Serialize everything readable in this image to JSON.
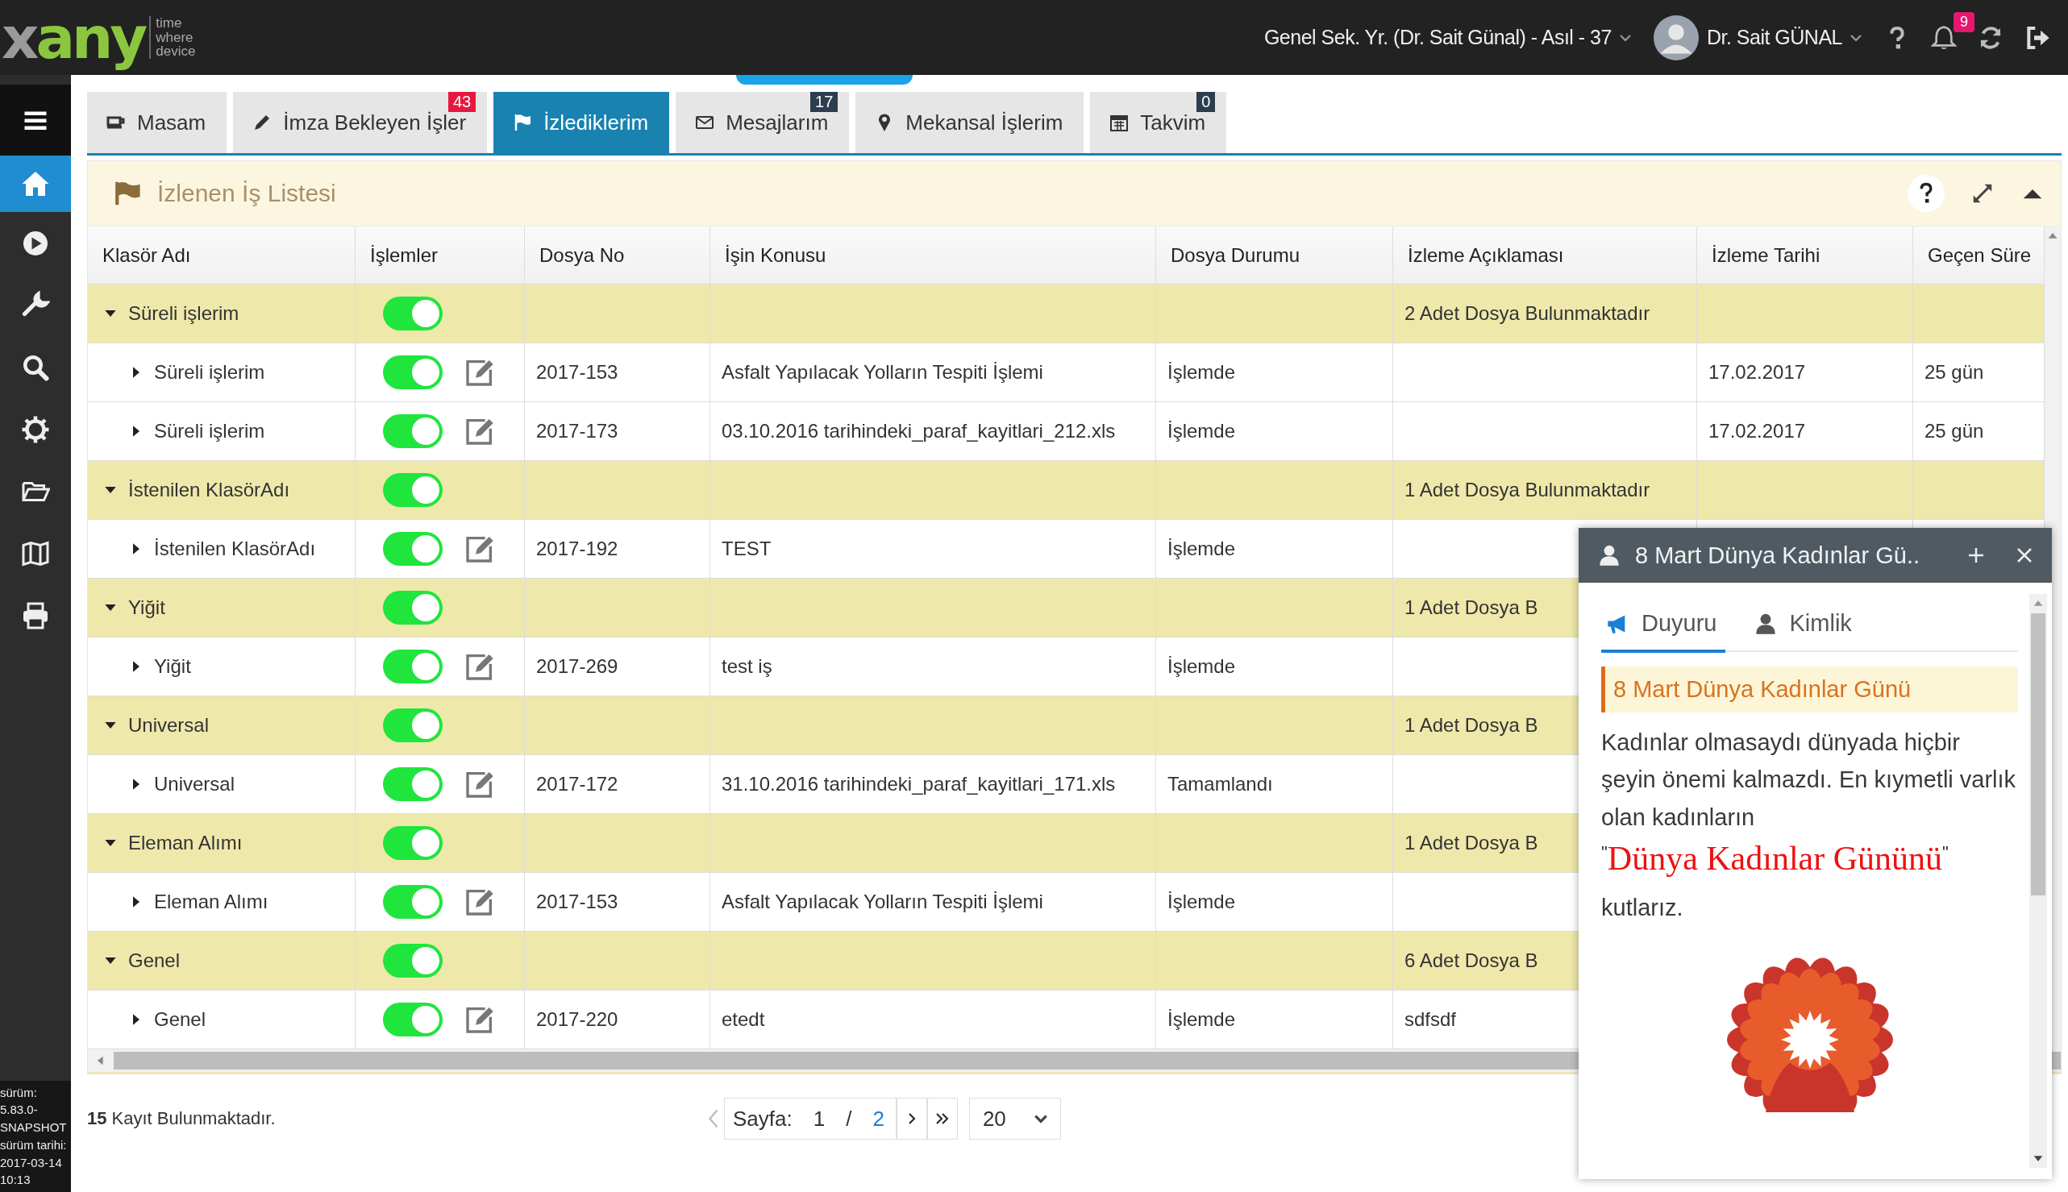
{
  "topbar": {
    "logo": {
      "mark_parts": [
        "x",
        "any"
      ],
      "tagline": [
        "time",
        "where",
        "device"
      ]
    },
    "role": "Genel Sek. Yr. (Dr. Sait Günal) - Asıl - 37",
    "user": "Dr. Sait GÜNAL",
    "notifications": "9"
  },
  "sidebar": {
    "items": [
      {
        "kind": "home",
        "selected": true
      },
      {
        "kind": "play",
        "selected": false
      },
      {
        "kind": "wrench",
        "selected": false
      },
      {
        "kind": "search",
        "selected": false
      },
      {
        "kind": "gear",
        "selected": false
      },
      {
        "kind": "folder",
        "selected": false
      },
      {
        "kind": "map",
        "selected": false
      },
      {
        "kind": "print",
        "selected": false
      }
    ],
    "version_lines": [
      "sürüm:",
      "5.83.0-",
      "SNAPSHOT",
      "sürüm tarihi:",
      "2017-03-14",
      "10:13"
    ]
  },
  "tabs": [
    {
      "label": "Masam",
      "kind": "coffee",
      "selected": false
    },
    {
      "label": "İmza Bekleyen İşler",
      "kind": "pencil",
      "selected": false,
      "badge": {
        "text": "43",
        "color": "#e8173f"
      }
    },
    {
      "label": "İzlediklerim",
      "kind": "flag",
      "selected": true
    },
    {
      "label": "Mesajlarım",
      "kind": "envelope",
      "selected": false,
      "badge": {
        "text": "17",
        "color": "#2c3e50"
      }
    },
    {
      "label": "Mekansal İşlerim",
      "kind": "marker",
      "selected": false
    },
    {
      "label": "Takvim",
      "kind": "calendar",
      "selected": false,
      "badge": {
        "text": "0",
        "color": "#2c3e50"
      }
    }
  ],
  "panel": {
    "title": "İzlenen İş Listesi"
  },
  "table": {
    "columns": [
      "Klasör Adı",
      "İşlemler",
      "Dosya No",
      "İşin Konusu",
      "Dosya Durumu",
      "İzleme Açıklaması",
      "İzleme Tarihi",
      "Geçen Süre"
    ],
    "groups": [
      {
        "folder": "Süreli işlerim",
        "expanded": true,
        "on": true,
        "note": "2 Adet Dosya Bulunmaktadır",
        "children": [
          {
            "folder": "Süreli işlerim",
            "expanded": false,
            "on": true,
            "file_no": "2017-153",
            "subject": "Asfalt Yapılacak Yolların Tespiti İşlemi",
            "status": "İşlemde",
            "date": "17.02.2017",
            "elapsed": "25 gün"
          },
          {
            "folder": "Süreli işlerim",
            "expanded": false,
            "on": true,
            "file_no": "2017-173",
            "subject": "03.10.2016 tarihindeki_paraf_kayitlari_212.xls",
            "status": "İşlemde",
            "date": "17.02.2017",
            "elapsed": "25 gün"
          }
        ]
      },
      {
        "folder": "İstenilen KlasörAdı",
        "expanded": true,
        "on": true,
        "note": "1 Adet Dosya Bulunmaktadır",
        "children": [
          {
            "folder": "İstenilen KlasörAdı",
            "expanded": false,
            "on": true,
            "file_no": "2017-192",
            "subject": "TEST",
            "status": "İşlemde"
          }
        ]
      },
      {
        "folder": "Yiğit",
        "expanded": true,
        "on": true,
        "note": "1 Adet Dosya B",
        "children": [
          {
            "folder": "Yiğit",
            "expanded": false,
            "on": true,
            "file_no": "2017-269",
            "subject": "test iş",
            "status": "İşlemde"
          }
        ]
      },
      {
        "folder": "Universal",
        "expanded": true,
        "on": true,
        "note": "1 Adet Dosya B",
        "children": [
          {
            "folder": "Universal",
            "expanded": false,
            "on": true,
            "file_no": "2017-172",
            "subject": "31.10.2016 tarihindeki_paraf_kayitlari_171.xls",
            "status": "Tamamlandı"
          }
        ]
      },
      {
        "folder": "Eleman Alımı",
        "expanded": true,
        "on": true,
        "note": "1 Adet Dosya B",
        "children": [
          {
            "folder": "Eleman Alımı",
            "expanded": false,
            "on": true,
            "file_no": "2017-153",
            "subject": "Asfalt Yapılacak Yolların Tespiti İşlemi",
            "status": "İşlemde"
          }
        ]
      },
      {
        "folder": "Genel",
        "expanded": true,
        "on": true,
        "note": "6 Adet Dosya B",
        "children": [
          {
            "folder": "Genel",
            "expanded": false,
            "on": true,
            "file_no": "2017-220",
            "subject": "etedt",
            "status": "İşlemde",
            "note": "sdfsdf"
          }
        ]
      }
    ]
  },
  "footer": {
    "count_text": "**15** Kayıt Bulunmaktadır.",
    "page_label": "Sayfa:",
    "page": "1",
    "separator": "/",
    "pages": "2",
    "page_size": "20"
  },
  "popup": {
    "title": "8 Mart Dünya Kadınlar Gü..",
    "tabs": [
      {
        "label": "Duyuru",
        "kind": "megaphone",
        "selected": true
      },
      {
        "label": "Kimlik",
        "kind": "user",
        "selected": false
      }
    ],
    "headline": "8 Mart Dünya Kadınlar Günü",
    "paragraph": "Kadınlar olmasaydı dünyada hiçbir şeyin önemi kalmazdı. En kıymetli varlık olan kadınların",
    "quote_open": "\"",
    "highlight": "Dünya Kadınlar Gününü",
    "quote_close": "\"",
    "closing": "kutlarız."
  }
}
